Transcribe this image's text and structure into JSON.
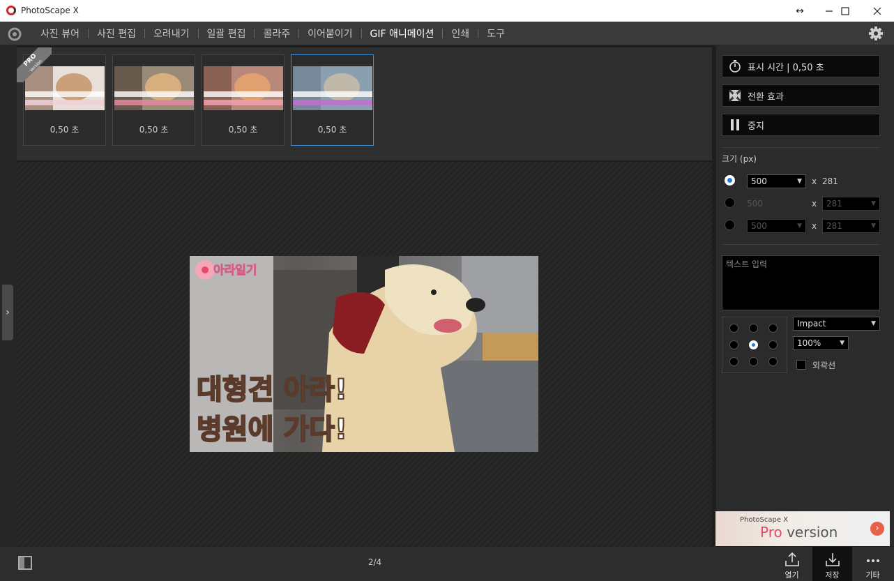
{
  "window": {
    "title": "PhotoScape X"
  },
  "menu": {
    "items": [
      "사진 뷰어",
      "사진 편집",
      "오려내기",
      "일괄 편집",
      "콜라주",
      "이어붙이기",
      "GIF 애니메이션",
      "인쇄",
      "도구"
    ],
    "active": "GIF 애니메이션"
  },
  "filmstrip": {
    "badge": "PRO",
    "badge_sub": "Version",
    "frames": [
      {
        "duration": "0,50 초",
        "selected": false
      },
      {
        "duration": "0,50 초",
        "selected": false
      },
      {
        "duration": "0,50 초",
        "selected": false
      },
      {
        "duration": "0,50 초",
        "selected": true
      }
    ]
  },
  "preview": {
    "overlay_top": "아라일기",
    "line1": "대형견 아라!",
    "line2_a": "병원",
    "line2_b": "에 가다!"
  },
  "panel": {
    "display_time": "표시 시간 | 0,50 초",
    "transition": "전환 효과",
    "stop": "중지",
    "size_label": "크기 (px)",
    "size_rows": [
      {
        "w": "500",
        "h": "281",
        "selected": true,
        "enabled": true
      },
      {
        "w": "500",
        "h": "281",
        "selected": false,
        "enabled": false
      },
      {
        "w": "500",
        "h": "281",
        "selected": false,
        "enabled": false
      }
    ],
    "x_sep": "x",
    "text_placeholder": "텍스트 입력",
    "font": "Impact",
    "zoom": "100%",
    "outline": "외곽선",
    "text_position": "center"
  },
  "promo": {
    "brand": "PhotoScape X",
    "pro": "Pro",
    "version": " version"
  },
  "bottom": {
    "pager": "2/4",
    "open": "열기",
    "save": "저장",
    "more": "기타"
  },
  "colors": {
    "accent": "#3a8fd8",
    "pink": "#f28aa4"
  }
}
